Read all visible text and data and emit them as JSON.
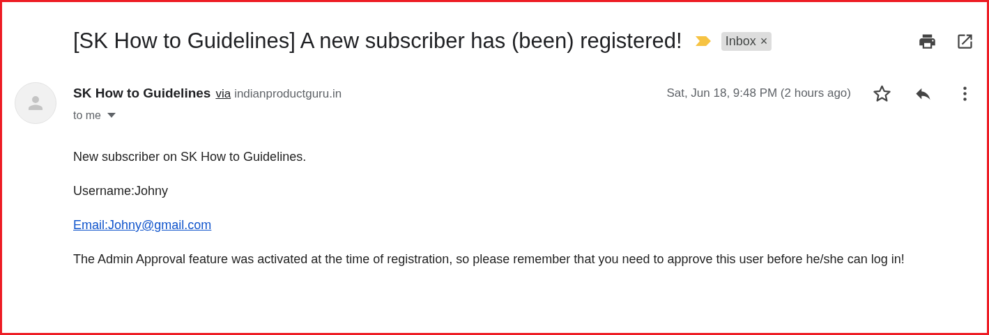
{
  "subject": {
    "title": "[SK How to Guidelines] A new subscriber has (been) registered!",
    "important": true,
    "labels": [
      {
        "text": "Inbox",
        "close": "×"
      }
    ]
  },
  "sender": {
    "name": "SK How to Guidelines",
    "via": "via",
    "domain": "indianproductguru.in",
    "recipient": "to me",
    "date": "Sat, Jun 18, 9:48 PM (2 hours ago)",
    "starred": false
  },
  "body": [
    {
      "kind": "text",
      "text": "New subscriber on SK How to Guidelines."
    },
    {
      "kind": "text",
      "text": "Username:Johny"
    },
    {
      "kind": "link",
      "text": "Email:Johny@gmail.com"
    },
    {
      "kind": "text",
      "text": "The Admin Approval feature was activated at the time of registration, so please remember that you need to approve this user before he/she can log in!"
    }
  ]
}
